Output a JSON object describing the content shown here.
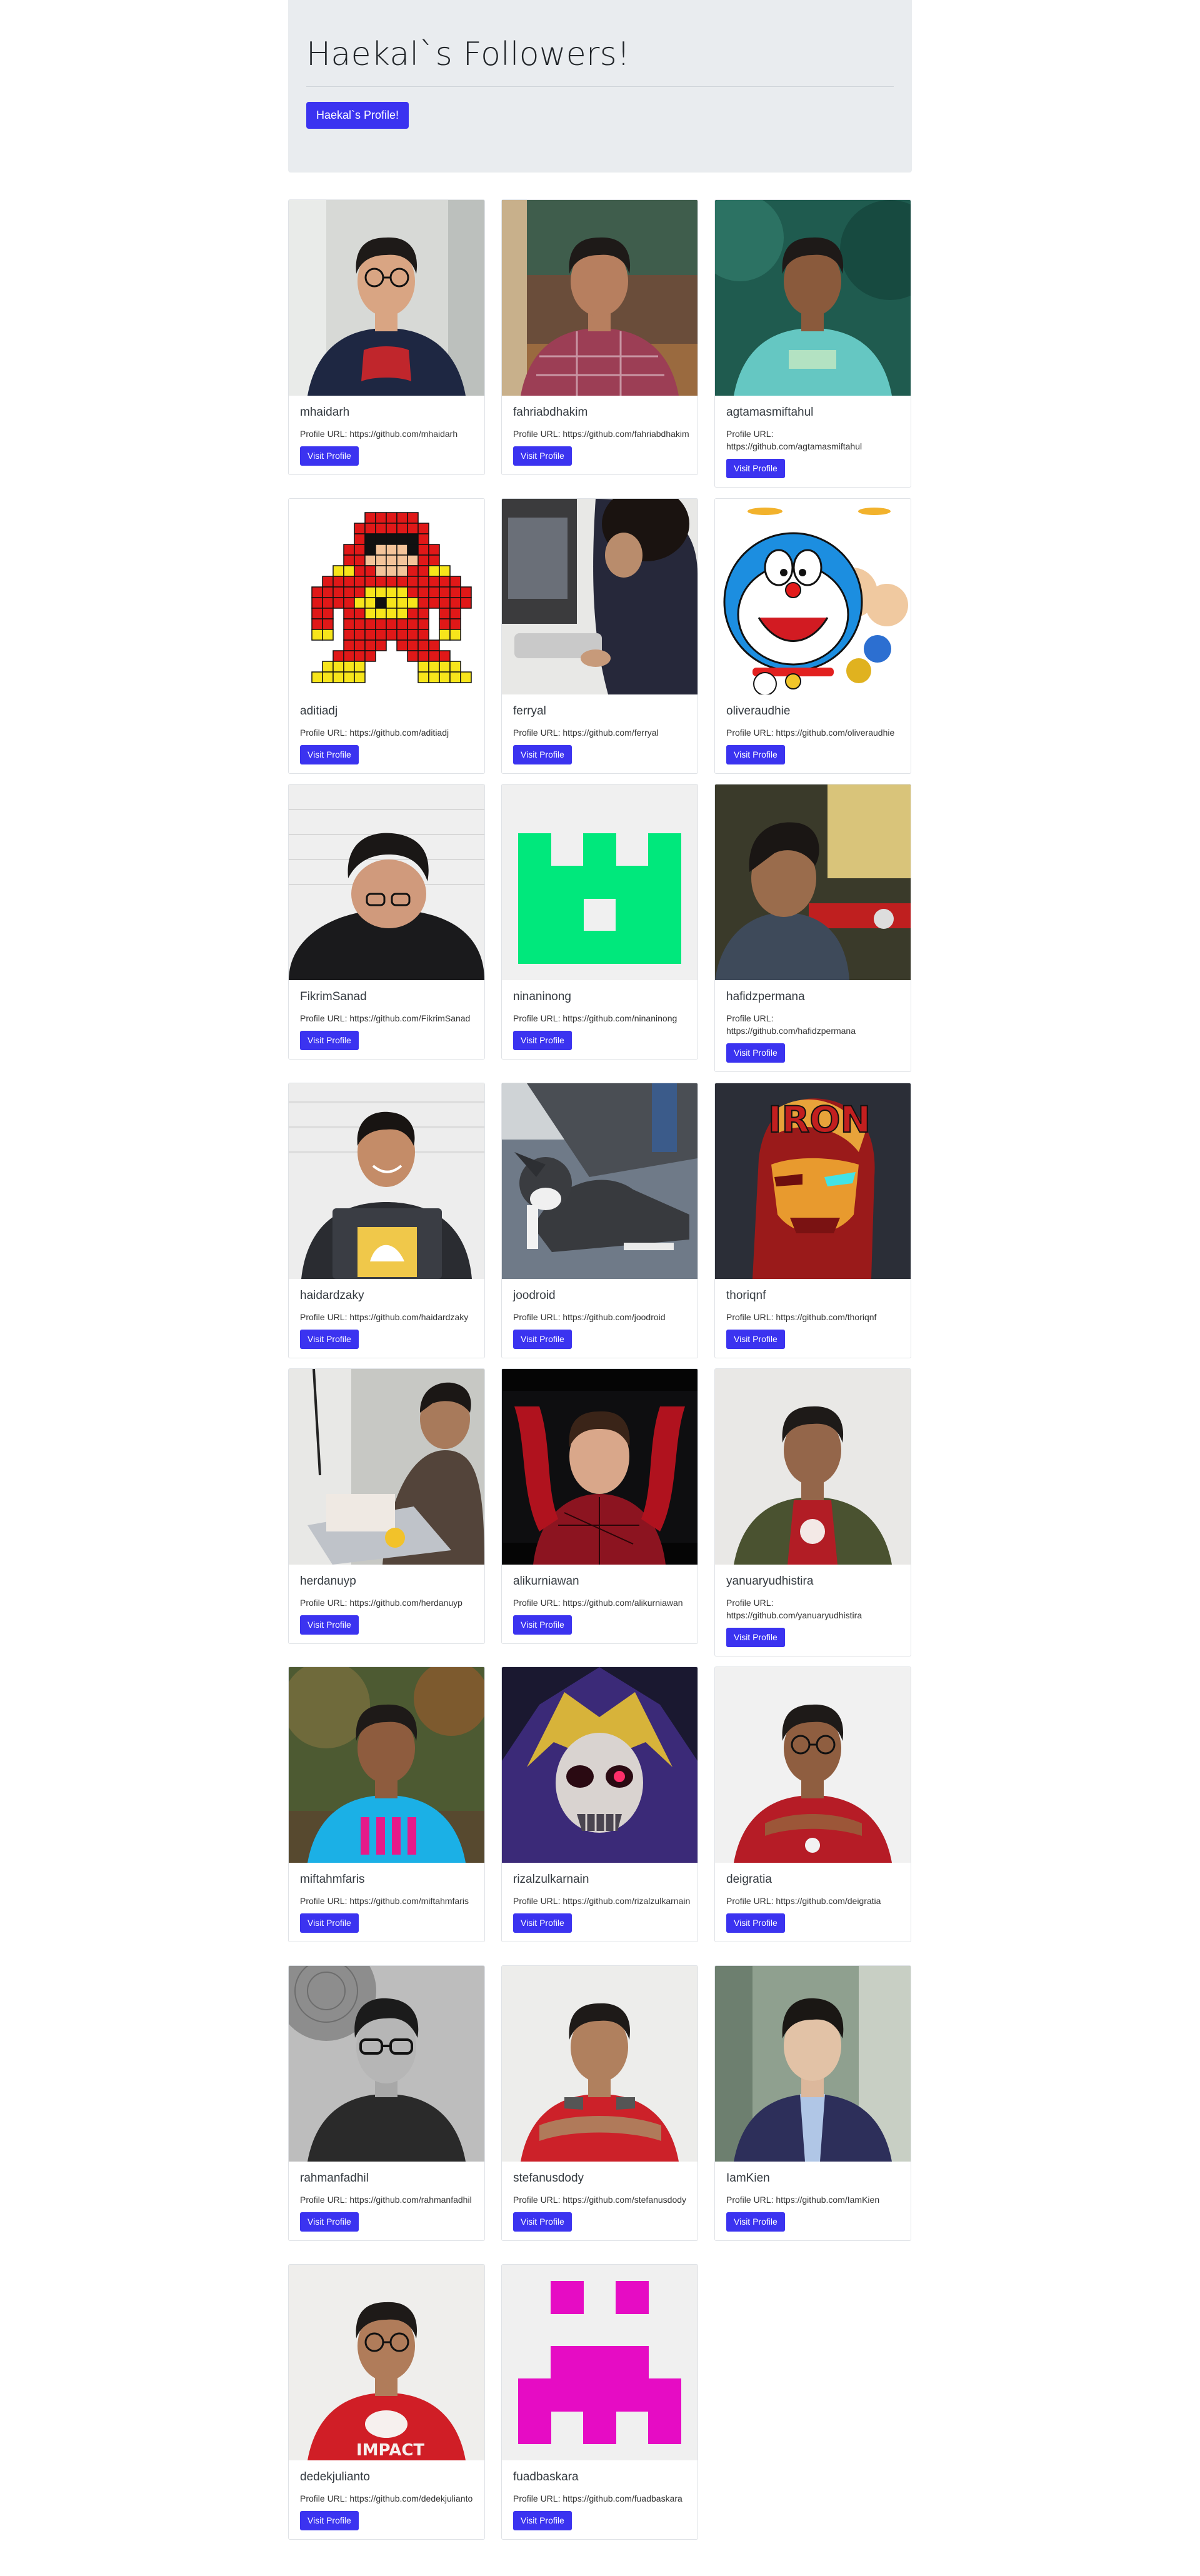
{
  "header": {
    "title": "Haekal`s Followers!",
    "profile_button": "Haekal`s Profile!"
  },
  "followers": [
    {
      "name": "mhaidarh",
      "url": "Profile URL: https://github.com/mhaidarh",
      "button": "Visit Profile",
      "avatar": "photo-glasses-man-red-shirt"
    },
    {
      "name": "fahriabdhakim",
      "url": "Profile URL: https://github.com/fahriabdhakim",
      "button": "Visit Profile",
      "avatar": "photo-man-plaid-shirt"
    },
    {
      "name": "agtamasmiftahul",
      "url": "Profile URL: https://github.com/agtamasmiftahul",
      "button": "Visit Profile",
      "avatar": "photo-man-teal-tshirt"
    },
    {
      "name": "aditiadj",
      "url": "Profile URL: https://github.com/aditiadj",
      "button": "Visit Profile",
      "avatar": "pixel-flash-sprite"
    },
    {
      "name": "ferryal",
      "url": "Profile URL: https://github.com/ferryal",
      "button": "Visit Profile",
      "avatar": "photo-person-laptop"
    },
    {
      "name": "oliveraudhie",
      "url": "Profile URL: https://github.com/oliveraudhie",
      "button": "Visit Profile",
      "avatar": "cartoon-doraemon"
    },
    {
      "name": "FikrimSanad",
      "url": "Profile URL: https://github.com/FikrimSanad",
      "button": "Visit Profile",
      "avatar": "photo-man-looking-down"
    },
    {
      "name": "ninaninong",
      "url": "Profile URL: https://github.com/ninaninong",
      "button": "Visit Profile",
      "avatar": "identicon-green"
    },
    {
      "name": "hafidzpermana",
      "url": "Profile URL: https://github.com/hafidzpermana",
      "button": "Visit Profile",
      "avatar": "photo-man-profile"
    },
    {
      "name": "haidardzaky",
      "url": "Profile URL: https://github.com/haidardzaky",
      "button": "Visit Profile",
      "avatar": "photo-man-laptop-smile"
    },
    {
      "name": "joodroid",
      "url": "Profile URL: https://github.com/joodroid",
      "button": "Visit Profile",
      "avatar": "photo-dog-pavement"
    },
    {
      "name": "thoriqnf",
      "url": "Profile URL: https://github.com/thoriqnf",
      "button": "Visit Profile",
      "avatar": "art-ironman"
    },
    {
      "name": "herdanuyp",
      "url": "Profile URL: https://github.com/herdanuyp",
      "button": "Visit Profile",
      "avatar": "photo-man-typing"
    },
    {
      "name": "alikurniawan",
      "url": "Profile URL: https://github.com/alikurniawan",
      "button": "Visit Profile",
      "avatar": "photo-spiderman"
    },
    {
      "name": "yanuaryudhistira",
      "url": "Profile URL: https://github.com/yanuaryudhistira",
      "button": "Visit Profile",
      "avatar": "photo-man-green-jacket"
    },
    {
      "name": "miftahmfaris",
      "url": "Profile URL: https://github.com/miftahmfaris",
      "button": "Visit Profile",
      "avatar": "photo-boy-blue-shirt"
    },
    {
      "name": "rizalzulkarnain",
      "url": "Profile URL: https://github.com/rizalzulkarnain",
      "button": "Visit Profile",
      "avatar": "art-skull-king"
    },
    {
      "name": "deigratia",
      "url": "Profile URL: https://github.com/deigratia",
      "button": "Visit Profile",
      "avatar": "photo-man-arms-crossed"
    },
    {
      "name": "rahmanfadhil",
      "url": "Profile URL: https://github.com/rahmanfadhil",
      "button": "Visit Profile",
      "avatar": "photo-bw-boy-glasses"
    },
    {
      "name": "stefanusdody",
      "url": "Profile URL: https://github.com/stefanusdody",
      "button": "Visit Profile",
      "avatar": "photo-man-red-shirt-arms"
    },
    {
      "name": "IamKien",
      "url": "Profile URL: https://github.com/IamKien",
      "button": "Visit Profile",
      "avatar": "photo-man-suit"
    },
    {
      "name": "dedekjulianto",
      "url": "Profile URL: https://github.com/dedekjulianto",
      "button": "Visit Profile",
      "avatar": "photo-man-impact-shirt"
    },
    {
      "name": "fuadbaskara",
      "url": "Profile URL: https://github.com/fuadbaskara",
      "button": "Visit Profile",
      "avatar": "identicon-magenta"
    }
  ]
}
